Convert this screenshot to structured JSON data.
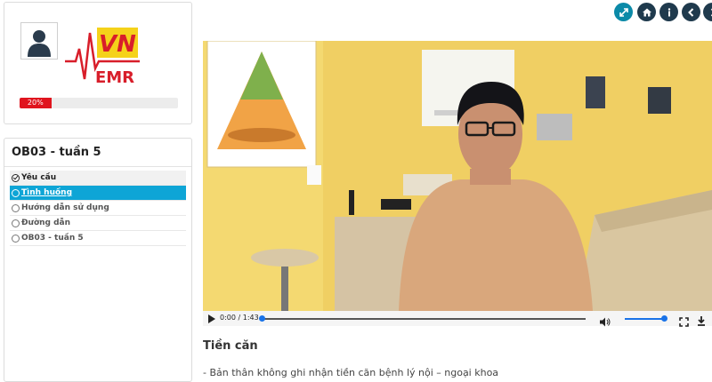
{
  "profile": {
    "logo_text_vn": "VN",
    "logo_text_emr": "EMR",
    "progress_label": "20%",
    "progress_value": 0.2,
    "progress_color": "#e0141e"
  },
  "nav": {
    "title": "OB03 - tuần 5",
    "items": [
      {
        "label": "Yêu cầu"
      },
      {
        "label": "Tình huống"
      },
      {
        "label": "Hướng dẫn sử dụng"
      },
      {
        "label": "Đường dẫn"
      },
      {
        "label": "OB03 - tuần 5"
      }
    ],
    "active_color": "#0ea5d6"
  },
  "toolbar": {
    "buttons": [
      {
        "icon": "fullscreen-icon",
        "color": "#0b8aa8"
      },
      {
        "icon": "home-icon",
        "color": "#1f3a4d"
      },
      {
        "icon": "info-icon",
        "color": "#1f3a4d"
      },
      {
        "icon": "back-icon",
        "color": "#1f3a4d"
      },
      {
        "icon": "more-icon",
        "color": "#1f3a4d"
      }
    ]
  },
  "video": {
    "time": "0:00 / 1:43",
    "progress": 0,
    "volume": 1
  },
  "content": {
    "heading": "Tiền căn",
    "history": "- Bản thân không ghi nhận tiền căn bệnh lý nội – ngoại khoa"
  }
}
